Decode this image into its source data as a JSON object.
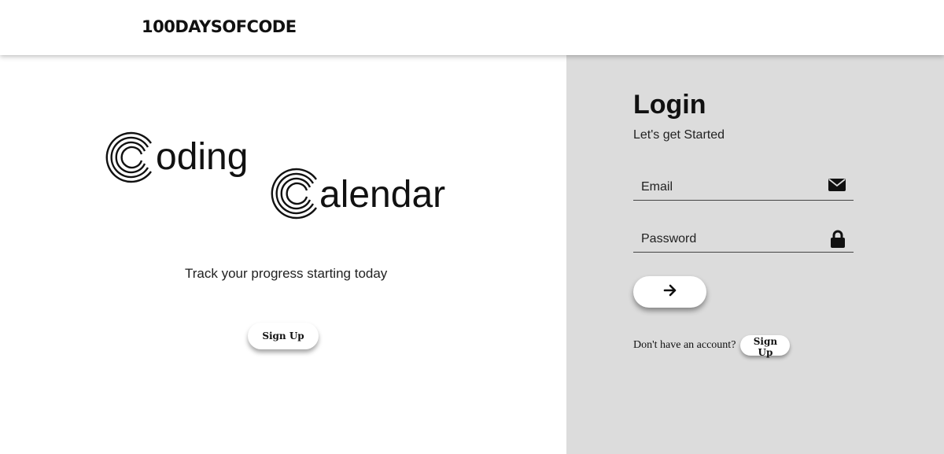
{
  "header": {
    "brand": "100DaysOfCode"
  },
  "hero": {
    "title_word1_initial": "C",
    "title_word1_rest": "oding",
    "title_word2_initial": "C",
    "title_word2_rest": "alendar",
    "tagline": "Track your progress starting today",
    "signup_label": "Sign Up"
  },
  "login": {
    "title": "Login",
    "subtitle": "Let's get Started",
    "email_placeholder": "Email",
    "password_placeholder": "Password",
    "submit_icon": "arrow-right-icon",
    "no_account_text": "Don't have an account?",
    "signup_label": "Sign Up"
  },
  "colors": {
    "panel_bg": "#dcdcdc",
    "text": "#111111"
  }
}
